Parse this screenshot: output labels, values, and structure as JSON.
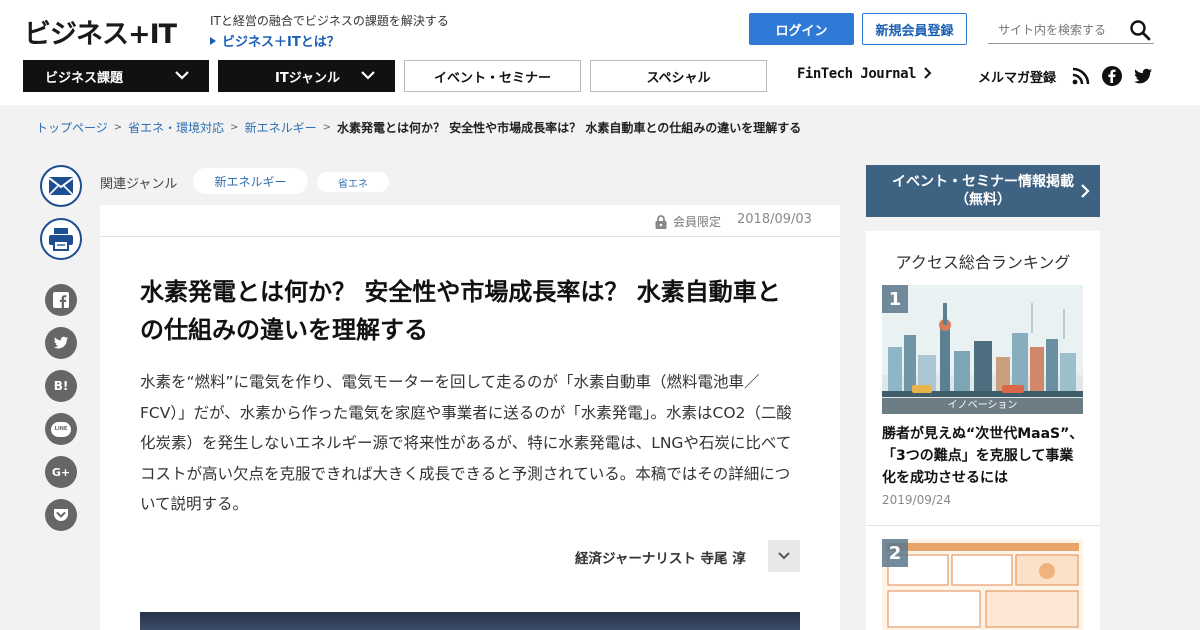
{
  "header": {
    "logo": "ビジネス+IT",
    "tagline": "ITと経営の融合でビジネスの課題を解決する",
    "about_link": "ビジネス＋ITとは？",
    "login_label": "ログイン",
    "register_label": "新規会員登録",
    "search_placeholder": "サイト内を検索する"
  },
  "nav": {
    "items": [
      {
        "label": "ビジネス課題"
      },
      {
        "label": "ITジャンル"
      },
      {
        "label": "イベント・セミナー"
      },
      {
        "label": "スペシャル"
      }
    ],
    "fintech": "FinTech Journal",
    "mailmag": "メルマガ登録"
  },
  "breadcrumb": [
    "トップページ",
    "省エネ・環境対応",
    "新エネルギー"
  ],
  "breadcrumb_current": "水素発電とは何か？ 安全性や市場成長率は？ 水素自動車との仕組みの違いを理解する",
  "share": {
    "icons": [
      "mail-icon",
      "print-icon",
      "facebook-icon",
      "twitter-icon",
      "hatena-icon",
      "line-icon",
      "googleplus-icon",
      "pocket-icon"
    ],
    "hatena": "B!",
    "line": "LINE",
    "gplus": "G+"
  },
  "article": {
    "genre_label": "関連ジャンル",
    "tags": [
      "新エネルギー",
      "省エネ"
    ],
    "members_only": "会員限定",
    "date": "2018/09/03",
    "title": "水素発電とは何か？ 安全性や市場成長率は？ 水素自動車との仕組みの違いを理解する",
    "lead": "水素を“燃料”に電気を作り、電気モーターを回して走るのが「水素自動車（燃料電池車／FCV）」だが、水素から作った電気を家庭や事業者に送るのが「水素発電」。水素はCO2（二酸化炭素）を発生しないエネルギー源で将来性があるが、特に水素発電は、LNGや石炭に比べてコストが高い欠点を克服できれば大きく成長できると予測されている。本稿ではその詳細について説明する。",
    "author": "経済ジャーナリスト 寺尾 淳"
  },
  "sidebar": {
    "event_banner_line1": "イベント・セミナー情報掲載",
    "event_banner_line2": "（無料）",
    "ranking_title": "アクセス総合ランキング",
    "rank1": {
      "num": "1",
      "category": "イノベーション",
      "headline": "勝者が見えぬ“次世代MaaS”、「3つの難点」を克服して事業化を成功させるには",
      "date": "2019/09/24"
    },
    "rank2": {
      "num": "2"
    }
  },
  "colors": {
    "accent_blue": "#2f7ad7",
    "link_blue": "#2f6fb3",
    "nav_dark": "#111111",
    "event_banner": "#3e6282"
  }
}
